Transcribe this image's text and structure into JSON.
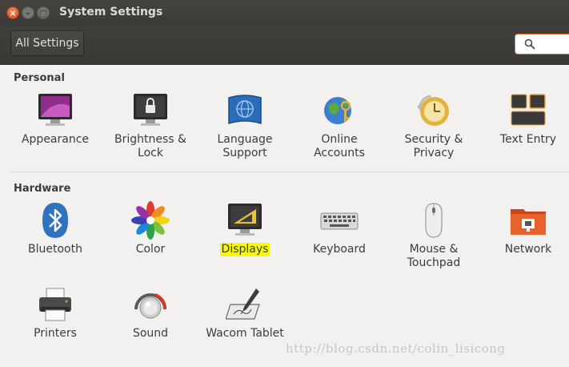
{
  "window": {
    "title": "System Settings",
    "buttons": {
      "close": "×",
      "minimize": "–",
      "maximize": "□"
    }
  },
  "toolbar": {
    "all_settings_label": "All Settings",
    "search_placeholder": ""
  },
  "sections": {
    "personal": {
      "title": "Personal",
      "items": [
        {
          "label_lines": [
            "Appearance"
          ],
          "icon": "appearance-icon"
        },
        {
          "label_lines": [
            "Brightness &",
            "Lock"
          ],
          "icon": "brightness-lock-icon"
        },
        {
          "label_lines": [
            "Language",
            "Support"
          ],
          "icon": "language-support-icon"
        },
        {
          "label_lines": [
            "Online",
            "Accounts"
          ],
          "icon": "online-accounts-icon"
        },
        {
          "label_lines": [
            "Security &",
            "Privacy"
          ],
          "icon": "security-privacy-icon"
        },
        {
          "label_lines": [
            "Text Entry"
          ],
          "icon": "text-entry-icon"
        }
      ]
    },
    "hardware": {
      "title": "Hardware",
      "items": [
        {
          "label_lines": [
            "Bluetooth"
          ],
          "icon": "bluetooth-icon"
        },
        {
          "label_lines": [
            "Color"
          ],
          "icon": "color-icon"
        },
        {
          "label_lines": [
            "Displays"
          ],
          "icon": "displays-icon",
          "highlighted": true
        },
        {
          "label_lines": [
            "Keyboard"
          ],
          "icon": "keyboard-icon"
        },
        {
          "label_lines": [
            "Mouse &",
            "Touchpad"
          ],
          "icon": "mouse-touchpad-icon"
        },
        {
          "label_lines": [
            "Network"
          ],
          "icon": "network-icon"
        },
        {
          "label_lines": [
            "Printers"
          ],
          "icon": "printer-icon"
        },
        {
          "label_lines": [
            "Sound"
          ],
          "icon": "sound-icon"
        },
        {
          "label_lines": [
            "Wacom Tablet"
          ],
          "icon": "wacom-tablet-icon"
        }
      ]
    }
  },
  "colors": {
    "titlebar": "#3b3a36",
    "close_button": "#df4a16",
    "search_border": "#e9702c",
    "highlight": "#f8f80b"
  },
  "watermark": "http://blog.csdn.net/colin_lisicong"
}
